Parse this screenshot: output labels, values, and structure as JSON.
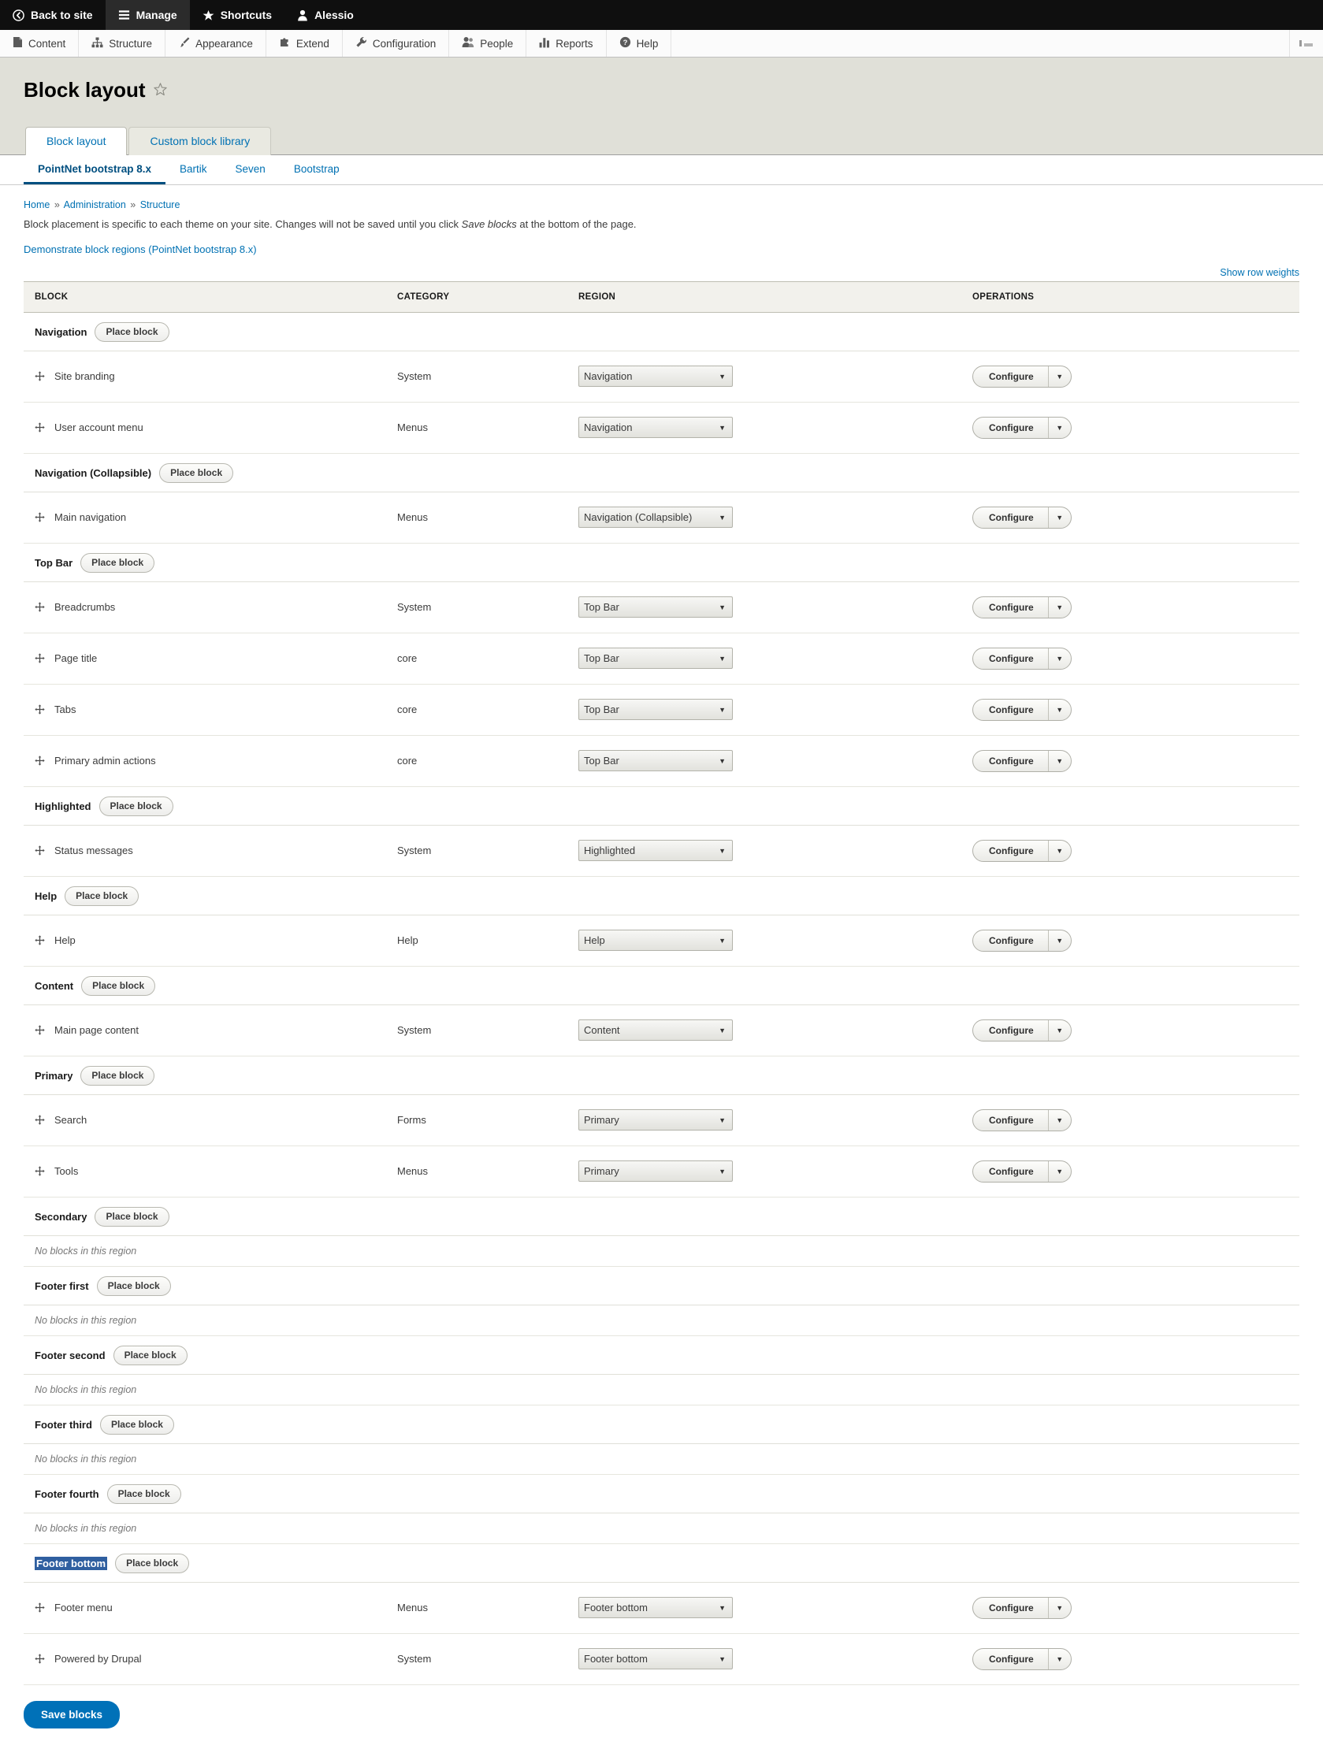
{
  "toolbar": {
    "tabs": [
      {
        "label": "Back to site",
        "icon": "back-arrow-icon",
        "active": false
      },
      {
        "label": "Manage",
        "icon": "hamburger-icon",
        "active": true
      },
      {
        "label": "Shortcuts",
        "icon": "star-icon",
        "active": false
      },
      {
        "label": "Alessio",
        "icon": "user-icon",
        "active": false
      }
    ],
    "menu": [
      {
        "label": "Content",
        "icon": "file-icon"
      },
      {
        "label": "Structure",
        "icon": "sitemap-icon"
      },
      {
        "label": "Appearance",
        "icon": "brush-icon"
      },
      {
        "label": "Extend",
        "icon": "puzzle-icon"
      },
      {
        "label": "Configuration",
        "icon": "wrench-icon"
      },
      {
        "label": "People",
        "icon": "people-icon"
      },
      {
        "label": "Reports",
        "icon": "bar-chart-icon"
      },
      {
        "label": "Help",
        "icon": "question-icon"
      }
    ],
    "orientation_toggle_icon": "tray-orientation-icon"
  },
  "header": {
    "title": "Block layout",
    "star_icon": "favorite-star-icon"
  },
  "primary_tabs": [
    {
      "label": "Block layout",
      "active": true
    },
    {
      "label": "Custom block library",
      "active": false
    }
  ],
  "theme_tabs": [
    {
      "label": "PointNet bootstrap 8.x",
      "active": true
    },
    {
      "label": "Bartik",
      "active": false
    },
    {
      "label": "Seven",
      "active": false
    },
    {
      "label": "Bootstrap",
      "active": false
    }
  ],
  "breadcrumb": [
    "Home",
    "Administration",
    "Structure"
  ],
  "breadcrumb_separator": "»",
  "help_text_before": "Block placement is specific to each theme on your site. Changes will not be saved until you click ",
  "help_text_em": "Save blocks",
  "help_text_after": " at the bottom of the page.",
  "demo_link": "Demonstrate block regions (PointNet bootstrap 8.x)",
  "show_row_weights": "Show row weights",
  "table": {
    "headers": {
      "block": "BLOCK",
      "category": "CATEGORY",
      "region": "REGION",
      "operations": "OPERATIONS"
    },
    "place_block_label": "Place block",
    "configure_label": "Configure",
    "empty_region_text": "No blocks in this region",
    "drag_icon": "drag-handle-icon",
    "dropdown_caret_icon": "chevron-down-icon"
  },
  "regions": [
    {
      "name": "Navigation",
      "selected": false,
      "blocks": [
        {
          "name": "Site branding",
          "category": "System",
          "region": "Navigation"
        },
        {
          "name": "User account menu",
          "category": "Menus",
          "region": "Navigation"
        }
      ]
    },
    {
      "name": "Navigation (Collapsible)",
      "selected": false,
      "blocks": [
        {
          "name": "Main navigation",
          "category": "Menus",
          "region": "Navigation (Collapsible)"
        }
      ]
    },
    {
      "name": "Top Bar",
      "selected": false,
      "blocks": [
        {
          "name": "Breadcrumbs",
          "category": "System",
          "region": "Top Bar"
        },
        {
          "name": "Page title",
          "category": "core",
          "region": "Top Bar"
        },
        {
          "name": "Tabs",
          "category": "core",
          "region": "Top Bar"
        },
        {
          "name": "Primary admin actions",
          "category": "core",
          "region": "Top Bar"
        }
      ]
    },
    {
      "name": "Highlighted",
      "selected": false,
      "blocks": [
        {
          "name": "Status messages",
          "category": "System",
          "region": "Highlighted"
        }
      ]
    },
    {
      "name": "Help",
      "selected": false,
      "blocks": [
        {
          "name": "Help",
          "category": "Help",
          "region": "Help"
        }
      ]
    },
    {
      "name": "Content",
      "selected": false,
      "blocks": [
        {
          "name": "Main page content",
          "category": "System",
          "region": "Content"
        }
      ]
    },
    {
      "name": "Primary",
      "selected": false,
      "blocks": [
        {
          "name": "Search",
          "category": "Forms",
          "region": "Primary"
        },
        {
          "name": "Tools",
          "category": "Menus",
          "region": "Primary"
        }
      ]
    },
    {
      "name": "Secondary",
      "selected": false,
      "blocks": []
    },
    {
      "name": "Footer first",
      "selected": false,
      "blocks": []
    },
    {
      "name": "Footer second",
      "selected": false,
      "blocks": []
    },
    {
      "name": "Footer third",
      "selected": false,
      "blocks": []
    },
    {
      "name": "Footer fourth",
      "selected": false,
      "blocks": []
    },
    {
      "name": "Footer bottom",
      "selected": true,
      "blocks": [
        {
          "name": "Footer menu",
          "category": "Menus",
          "region": "Footer bottom"
        },
        {
          "name": "Powered by Drupal",
          "category": "System",
          "region": "Footer bottom"
        }
      ]
    }
  ],
  "save_button": "Save blocks",
  "colors": {
    "toolbar_bg": "#0f0f0f",
    "header_bg": "#e0e0d8",
    "link": "#0071b3",
    "active_tab_underline": "#004f80",
    "save_button": "#0071b8",
    "selection_highlight": "#2f5fa0"
  }
}
